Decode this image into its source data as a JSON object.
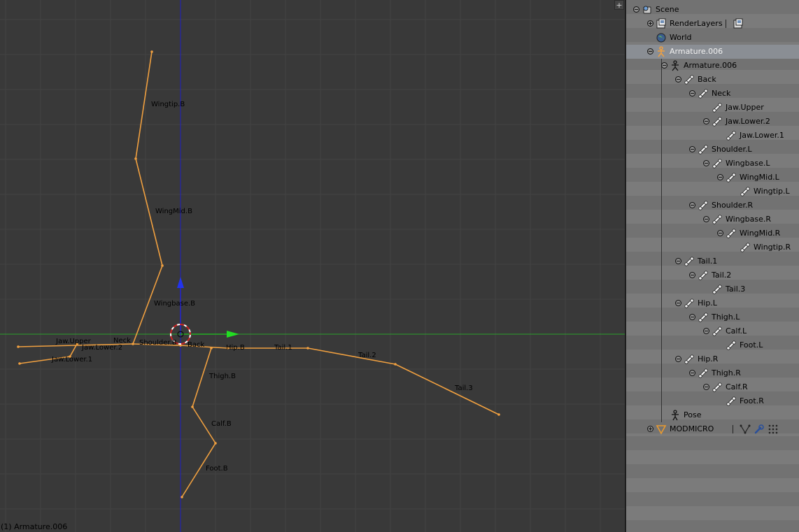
{
  "viewport": {
    "status_text": "(1) Armature.006",
    "corner_button": "+",
    "bone_labels": [
      "Wingtip.B",
      "WingMid.B",
      "Wingbase.B",
      "Jaw.Upper",
      "Jaw.Lower.2",
      "Jaw.Lower.1",
      "Neck",
      "Shoulder.B",
      "Back",
      "Hip.B",
      "Tail.1",
      "Tail.2",
      "Tail.3",
      "Thigh.B",
      "Calf.B",
      "Foot.B"
    ]
  },
  "outliner": {
    "items": [
      {
        "label": "Scene",
        "icon": "scene-icon"
      },
      {
        "label": "RenderLayers",
        "icon": "render-layers-icon"
      },
      {
        "label": "World",
        "icon": "world-icon"
      },
      {
        "label": "Armature.006",
        "icon": "armature-object-icon"
      },
      {
        "label": "Armature.006",
        "icon": "armature-data-icon"
      },
      {
        "label": "Back",
        "icon": "bone-icon"
      },
      {
        "label": "Neck",
        "icon": "bone-icon"
      },
      {
        "label": "Jaw.Upper",
        "icon": "bone-icon"
      },
      {
        "label": "Jaw.Lower.2",
        "icon": "bone-icon"
      },
      {
        "label": "Jaw.Lower.1",
        "icon": "bone-icon"
      },
      {
        "label": "Shoulder.L",
        "icon": "bone-icon"
      },
      {
        "label": "Wingbase.L",
        "icon": "bone-icon"
      },
      {
        "label": "WingMid.L",
        "icon": "bone-icon"
      },
      {
        "label": "Wingtip.L",
        "icon": "bone-icon"
      },
      {
        "label": "Shoulder.R",
        "icon": "bone-icon"
      },
      {
        "label": "Wingbase.R",
        "icon": "bone-icon"
      },
      {
        "label": "WingMid.R",
        "icon": "bone-icon"
      },
      {
        "label": "Wingtip.R",
        "icon": "bone-icon"
      },
      {
        "label": "Tail.1",
        "icon": "bone-icon"
      },
      {
        "label": "Tail.2",
        "icon": "bone-icon"
      },
      {
        "label": "Tail.3",
        "icon": "bone-icon"
      },
      {
        "label": "Hip.L",
        "icon": "bone-icon"
      },
      {
        "label": "Thigh.L",
        "icon": "bone-icon"
      },
      {
        "label": "Calf.L",
        "icon": "bone-icon"
      },
      {
        "label": "Foot.L",
        "icon": "bone-icon"
      },
      {
        "label": "Hip.R",
        "icon": "bone-icon"
      },
      {
        "label": "Thigh.R",
        "icon": "bone-icon"
      },
      {
        "label": "Calf.R",
        "icon": "bone-icon"
      },
      {
        "label": "Foot.R",
        "icon": "bone-icon"
      },
      {
        "label": "Pose",
        "icon": "pose-icon"
      },
      {
        "label": "MODMICRO",
        "icon": "mesh-icon"
      }
    ],
    "selected_item": "Armature.006"
  },
  "colors": {
    "viewport_bg": "#393939",
    "grid": "#424242",
    "bone_selected": "#f0a040",
    "axis_x": "#2aa02a",
    "axis_z": "#2020c0",
    "outliner_row_a": "#727272",
    "outliner_row_b": "#7b7b7b"
  }
}
